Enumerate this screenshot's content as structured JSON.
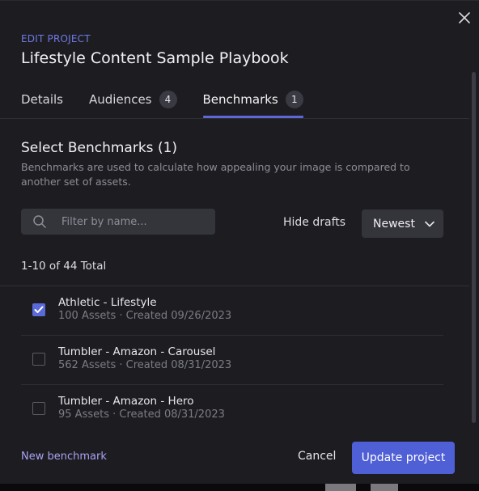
{
  "modal": {
    "eyebrow": "EDIT PROJECT",
    "title": "Lifestyle Content Sample Playbook",
    "close_icon": "close-icon"
  },
  "tabs": [
    {
      "label": "Details",
      "badge": null,
      "active": false
    },
    {
      "label": "Audiences",
      "badge": "4",
      "active": false
    },
    {
      "label": "Benchmarks",
      "badge": "1",
      "active": true
    }
  ],
  "section": {
    "title": "Select Benchmarks (1)",
    "description": "Benchmarks are used to calculate how appealing your image is compared to another set of assets."
  },
  "filters": {
    "search_placeholder": "Filter by name...",
    "search_value": "",
    "search_icon": "search-icon",
    "hide_drafts_label": "Hide drafts",
    "sort_label": "Newest",
    "sort_icon": "chevron-down-icon"
  },
  "list": {
    "count_label": "1-10 of 44 Total",
    "items": [
      {
        "name": "Athletic - Lifestyle",
        "meta": "100 Assets · Created 09/26/2023",
        "checked": true
      },
      {
        "name": "Tumbler - Amazon - Carousel",
        "meta": "562 Assets · Created 08/31/2023",
        "checked": false
      },
      {
        "name": "Tumbler - Amazon - Hero",
        "meta": "95 Assets · Created 08/31/2023",
        "checked": false
      }
    ]
  },
  "footer": {
    "new_benchmark_label": "New benchmark",
    "cancel_label": "Cancel",
    "submit_label": "Update project"
  },
  "colors": {
    "accent": "#5f67d8",
    "primary_button": "#4f5fd6",
    "link": "#a9a2f3",
    "eyebrow": "#6f79e6",
    "modal_bg": "#1d1d21"
  }
}
